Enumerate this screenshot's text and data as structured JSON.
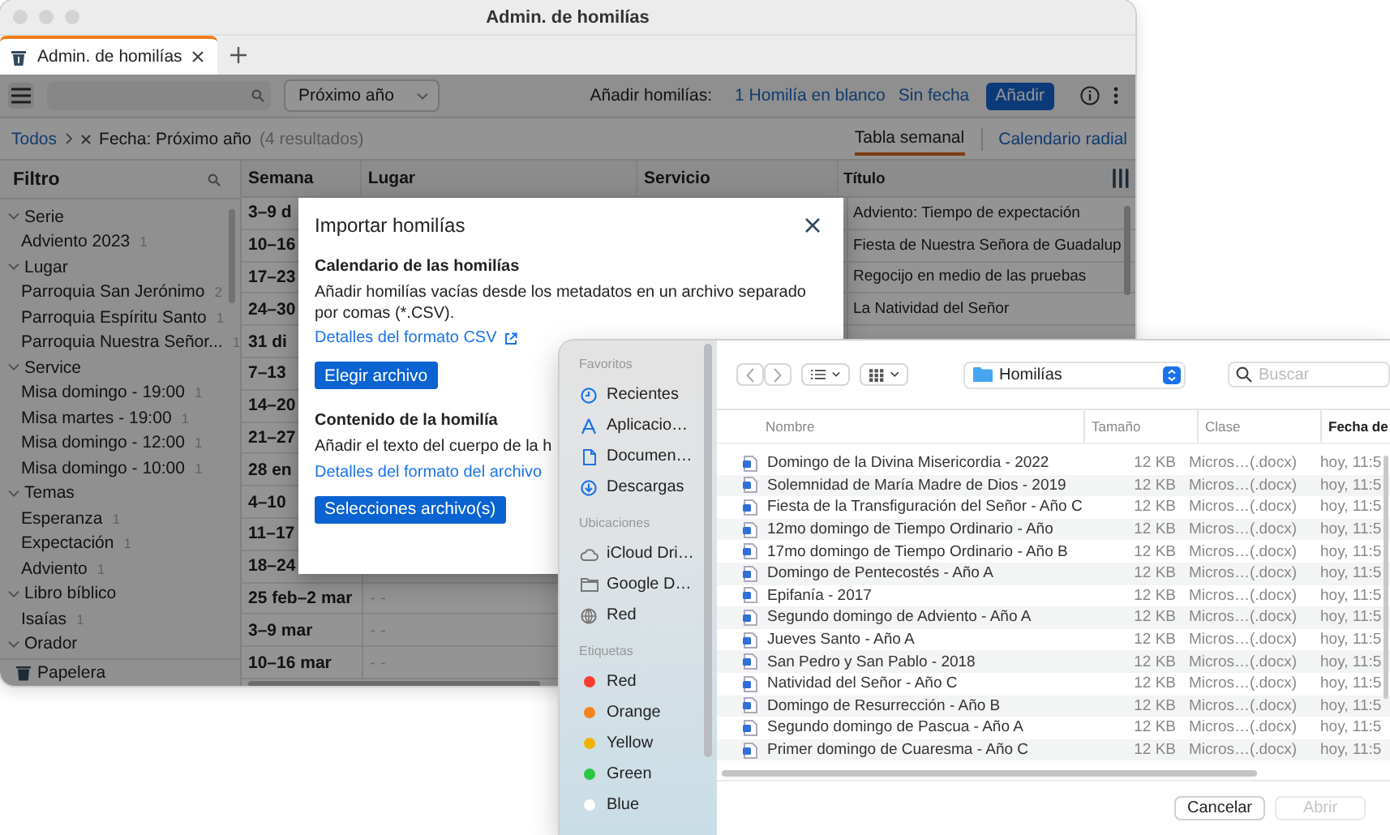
{
  "main_window": {
    "title": "Admin. de homilías",
    "tabs": [
      {
        "label": "Admin. de homilías",
        "selected": true
      }
    ],
    "toolbar": {
      "date_filter": "Próximo año",
      "add_label": "Añadir homilías:",
      "add_options": [
        "1 Homilía en blanco",
        "Sin fecha"
      ],
      "add_button": "Añadir"
    },
    "breadcrumb": {
      "root": "Todos",
      "filter": "Fecha: Próximo año",
      "count": "(4 resultados)"
    },
    "view_tabs": [
      {
        "label": "Tabla semanal",
        "selected": true
      },
      {
        "label": "Calendario radial",
        "selected": false
      }
    ],
    "filter_panel": {
      "title": "Filtro",
      "groups": [
        {
          "label": "Serie",
          "expanded": true,
          "children": [
            {
              "label": "Adviento 2023",
              "count": "1"
            }
          ]
        },
        {
          "label": "Lugar",
          "expanded": true,
          "children": [
            {
              "label": "Parroquia San Jerónimo",
              "count": "2"
            },
            {
              "label": "Parroquia Espíritu Santo",
              "count": "1"
            },
            {
              "label": "Parroquia Nuestra Señor...",
              "count": "1"
            }
          ]
        },
        {
          "label": "Service",
          "expanded": true,
          "children": [
            {
              "label": "Misa domingo - 19:00",
              "count": "1"
            },
            {
              "label": "Misa martes - 19:00",
              "count": "1"
            },
            {
              "label": "Misa domingo - 12:00",
              "count": "1"
            },
            {
              "label": "Misa domingo - 10:00",
              "count": "1"
            }
          ]
        },
        {
          "label": "Temas",
          "expanded": true,
          "children": [
            {
              "label": "Esperanza",
              "count": "1"
            },
            {
              "label": "Expectación",
              "count": "1"
            },
            {
              "label": "Adviento",
              "count": "1"
            }
          ]
        },
        {
          "label": "Libro bíblico",
          "expanded": true,
          "children": [
            {
              "label": "Isaías",
              "count": "1"
            }
          ]
        },
        {
          "label": "Orador",
          "expanded": true
        }
      ],
      "trash": "Papelera"
    },
    "table": {
      "columns": [
        "Semana",
        "Lugar",
        "Servicio",
        "Título"
      ],
      "rows": [
        {
          "week": "3–9 d",
          "title": "Adviento: Tiempo de expectación"
        },
        {
          "week": "10–16",
          "title": "Fiesta de Nuestra Señora de Guadalup"
        },
        {
          "week": "17–23",
          "title": "Regocijo en medio de las pruebas"
        },
        {
          "week": "24–30",
          "title": "La Natividad del Señor"
        },
        {
          "week": "31 di"
        },
        {
          "week": "7–13"
        },
        {
          "week": "14–20"
        },
        {
          "week": "21–27"
        },
        {
          "week": "28 en"
        },
        {
          "week": "4–10"
        },
        {
          "week": "11–17"
        },
        {
          "week": "18–24"
        },
        {
          "week": "25 feb–2 mar",
          "place": "- -"
        },
        {
          "week": "3–9 mar",
          "place": "- -"
        },
        {
          "week": "10–16 mar",
          "place": "- -"
        }
      ]
    }
  },
  "import_dialog": {
    "title": "Importar homilías",
    "sections": [
      {
        "heading": "Calendario de las homilías",
        "text": "Añadir homilías vacías desde los metadatos en un archivo separado por comas (*.CSV).",
        "link": "Detalles del formato CSV",
        "external": true,
        "button": "Elegir archivo"
      },
      {
        "heading": "Contenido de la homilía",
        "text": "Añadir el texto del cuerpo de la h",
        "link": "Detalles del formato del archivo",
        "external": false,
        "button": "Selecciones archivo(s)"
      }
    ]
  },
  "file_picker": {
    "sidebar": [
      {
        "heading": "Favoritos",
        "items": [
          {
            "label": "Recientes",
            "kind": "clock"
          },
          {
            "label": "Aplicacio…",
            "kind": "apps"
          },
          {
            "label": "Documen…",
            "kind": "document"
          },
          {
            "label": "Descargas",
            "kind": "download"
          }
        ]
      },
      {
        "heading": "Ubicaciones",
        "items": [
          {
            "label": "iCloud Dri…",
            "kind": "cloud"
          },
          {
            "label": "Google D…",
            "kind": "folder"
          },
          {
            "label": "Red",
            "kind": "globe"
          }
        ]
      },
      {
        "heading": "Etiquetas",
        "items": [
          {
            "label": "Red",
            "kind": "tag",
            "color": "#ff3b30"
          },
          {
            "label": "Orange",
            "kind": "tag",
            "color": "#f5841f"
          },
          {
            "label": "Yellow",
            "kind": "tag",
            "color": "#f0b400"
          },
          {
            "label": "Green",
            "kind": "tag",
            "color": "#28c840"
          },
          {
            "label": "Blue",
            "kind": "tag",
            "color": "#ffffff"
          }
        ]
      }
    ],
    "folder": "Homilías",
    "search_placeholder": "Buscar",
    "columns": [
      "Nombre",
      "Tamaño",
      "Clase",
      "Fecha de"
    ],
    "files": [
      {
        "name": "Domingo de la Divina Misericordia - 2022",
        "size": "12 KB",
        "class": "Micros…(.docx)",
        "date": "hoy, 11:5"
      },
      {
        "name": "Solemnidad de María Madre de Dios - 2019",
        "size": "12 KB",
        "class": "Micros…(.docx)",
        "date": "hoy, 11:5"
      },
      {
        "name": "Fiesta de la Transfiguración del Señor - Año C",
        "size": "12 KB",
        "class": "Micros…(.docx)",
        "date": "hoy, 11:5"
      },
      {
        "name": "12mo domingo de Tiempo Ordinario - Año",
        "size": "12 KB",
        "class": "Micros…(.docx)",
        "date": "hoy, 11:5"
      },
      {
        "name": "17mo domingo de Tiempo Ordinario - Año B",
        "size": "12 KB",
        "class": "Micros…(.docx)",
        "date": "hoy, 11:5"
      },
      {
        "name": "Domingo de Pentecostés - Año A",
        "size": "12 KB",
        "class": "Micros…(.docx)",
        "date": "hoy, 11:5"
      },
      {
        "name": "Epifanía - 2017",
        "size": "12 KB",
        "class": "Micros…(.docx)",
        "date": "hoy, 11:5"
      },
      {
        "name": "Segundo domingo de Adviento - Año A",
        "size": "12 KB",
        "class": "Micros…(.docx)",
        "date": "hoy, 11:5"
      },
      {
        "name": "Jueves Santo - Año A",
        "size": "12 KB",
        "class": "Micros…(.docx)",
        "date": "hoy, 11:5"
      },
      {
        "name": "San Pedro y San Pablo - 2018",
        "size": "12 KB",
        "class": "Micros…(.docx)",
        "date": "hoy, 11:5"
      },
      {
        "name": "Natividad del Señor - Año C",
        "size": "12 KB",
        "class": "Micros…(.docx)",
        "date": "hoy, 11:5"
      },
      {
        "name": "Domingo de Resurrección - Año B",
        "size": "12 KB",
        "class": "Micros…(.docx)",
        "date": "hoy, 11:5"
      },
      {
        "name": "Segundo domingo de Pascua - Año A",
        "size": "12 KB",
        "class": "Micros…(.docx)",
        "date": "hoy, 11:5"
      },
      {
        "name": "Primer domingo de Cuaresma - Año C",
        "size": "12 KB",
        "class": "Micros…(.docx)",
        "date": "hoy, 11:5"
      }
    ],
    "buttons": [
      {
        "label": "Cancelar",
        "disabled": false
      },
      {
        "label": "Abrir",
        "disabled": true
      }
    ]
  }
}
